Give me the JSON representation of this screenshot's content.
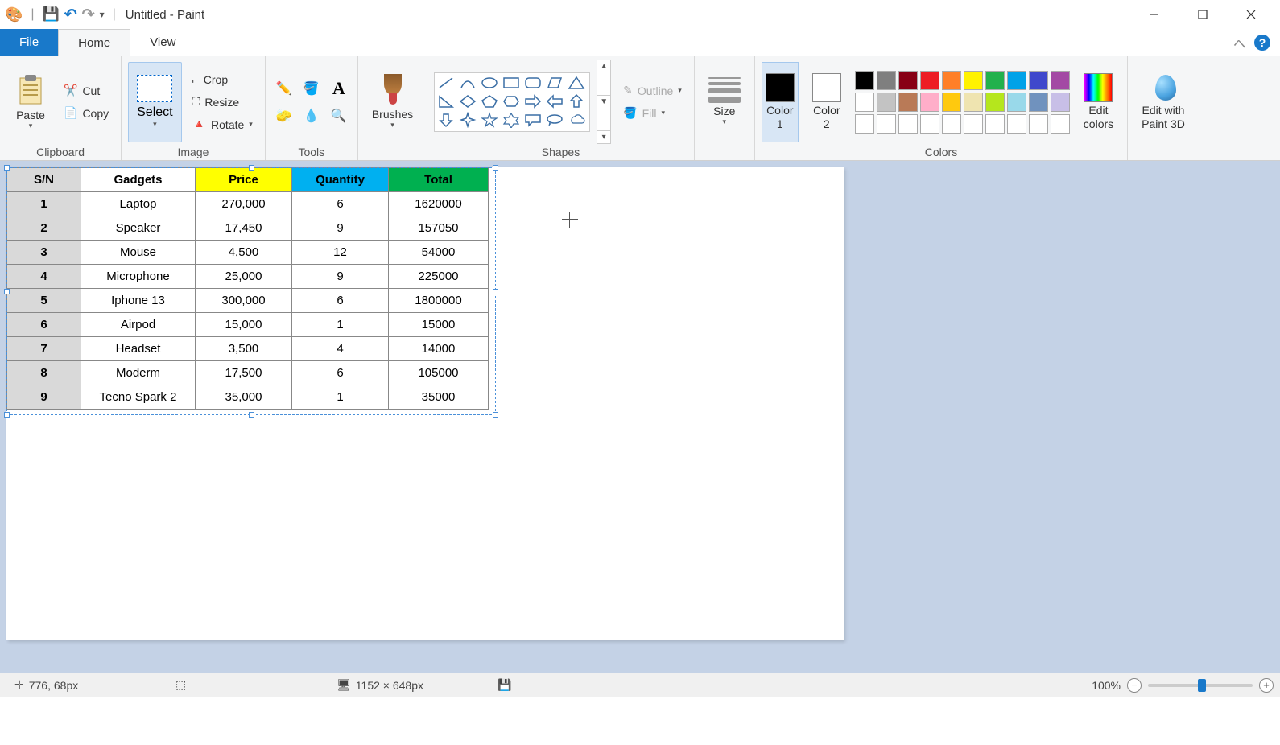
{
  "window": {
    "title": "Untitled - Paint"
  },
  "tabs": {
    "file": "File",
    "home": "Home",
    "view": "View"
  },
  "ribbon": {
    "clipboard": {
      "paste": "Paste",
      "cut": "Cut",
      "copy": "Copy",
      "group": "Clipboard"
    },
    "image": {
      "select": "Select",
      "crop": "Crop",
      "resize": "Resize",
      "rotate": "Rotate",
      "group": "Image"
    },
    "tools": {
      "group": "Tools"
    },
    "brushes": {
      "label": "Brushes"
    },
    "shapes": {
      "outline": "Outline",
      "fill": "Fill",
      "group": "Shapes"
    },
    "size": {
      "label": "Size"
    },
    "colors": {
      "color1": "Color\n1",
      "color2": "Color\n2",
      "editcolors": "Edit\ncolors",
      "group": "Colors"
    },
    "paint3d": {
      "label": "Edit with\nPaint 3D"
    }
  },
  "palette_row1": [
    "#000000",
    "#7f7f7f",
    "#880015",
    "#ed1c24",
    "#ff7f27",
    "#fff200",
    "#22b14c",
    "#00a2e8",
    "#3f48cc",
    "#a349a4"
  ],
  "palette_row2": [
    "#ffffff",
    "#c3c3c3",
    "#b97a57",
    "#ffaec9",
    "#ffc90e",
    "#efe4b0",
    "#b5e61d",
    "#99d9ea",
    "#7092be",
    "#c8bfe7"
  ],
  "palette_row3": [
    "#ffffff",
    "#ffffff",
    "#ffffff",
    "#ffffff",
    "#ffffff",
    "#ffffff",
    "#ffffff",
    "#ffffff",
    "#ffffff",
    "#ffffff"
  ],
  "color1_value": "#000000",
  "color2_value": "#ffffff",
  "table": {
    "headers": {
      "sn": "S/N",
      "gadgets": "Gadgets",
      "price": "Price",
      "quantity": "Quantity",
      "total": "Total"
    },
    "rows": [
      {
        "n": "1",
        "gadget": "Laptop",
        "price": "270,000",
        "qty": "6",
        "total": "1620000"
      },
      {
        "n": "2",
        "gadget": "Speaker",
        "price": "17,450",
        "qty": "9",
        "total": "157050"
      },
      {
        "n": "3",
        "gadget": "Mouse",
        "price": "4,500",
        "qty": "12",
        "total": "54000"
      },
      {
        "n": "4",
        "gadget": "Microphone",
        "price": "25,000",
        "qty": "9",
        "total": "225000"
      },
      {
        "n": "5",
        "gadget": "Iphone 13",
        "price": "300,000",
        "qty": "6",
        "total": "1800000"
      },
      {
        "n": "6",
        "gadget": "Airpod",
        "price": "15,000",
        "qty": "1",
        "total": "15000"
      },
      {
        "n": "7",
        "gadget": "Headset",
        "price": "3,500",
        "qty": "4",
        "total": "14000"
      },
      {
        "n": "8",
        "gadget": "Moderm",
        "price": "17,500",
        "qty": "6",
        "total": "105000"
      },
      {
        "n": "9",
        "gadget": "Tecno Spark 2",
        "price": "35,000",
        "qty": "1",
        "total": "35000"
      }
    ]
  },
  "status": {
    "cursor_pos": "776, 68px",
    "canvas_size": "1152 × 648px",
    "zoom": "100%"
  }
}
